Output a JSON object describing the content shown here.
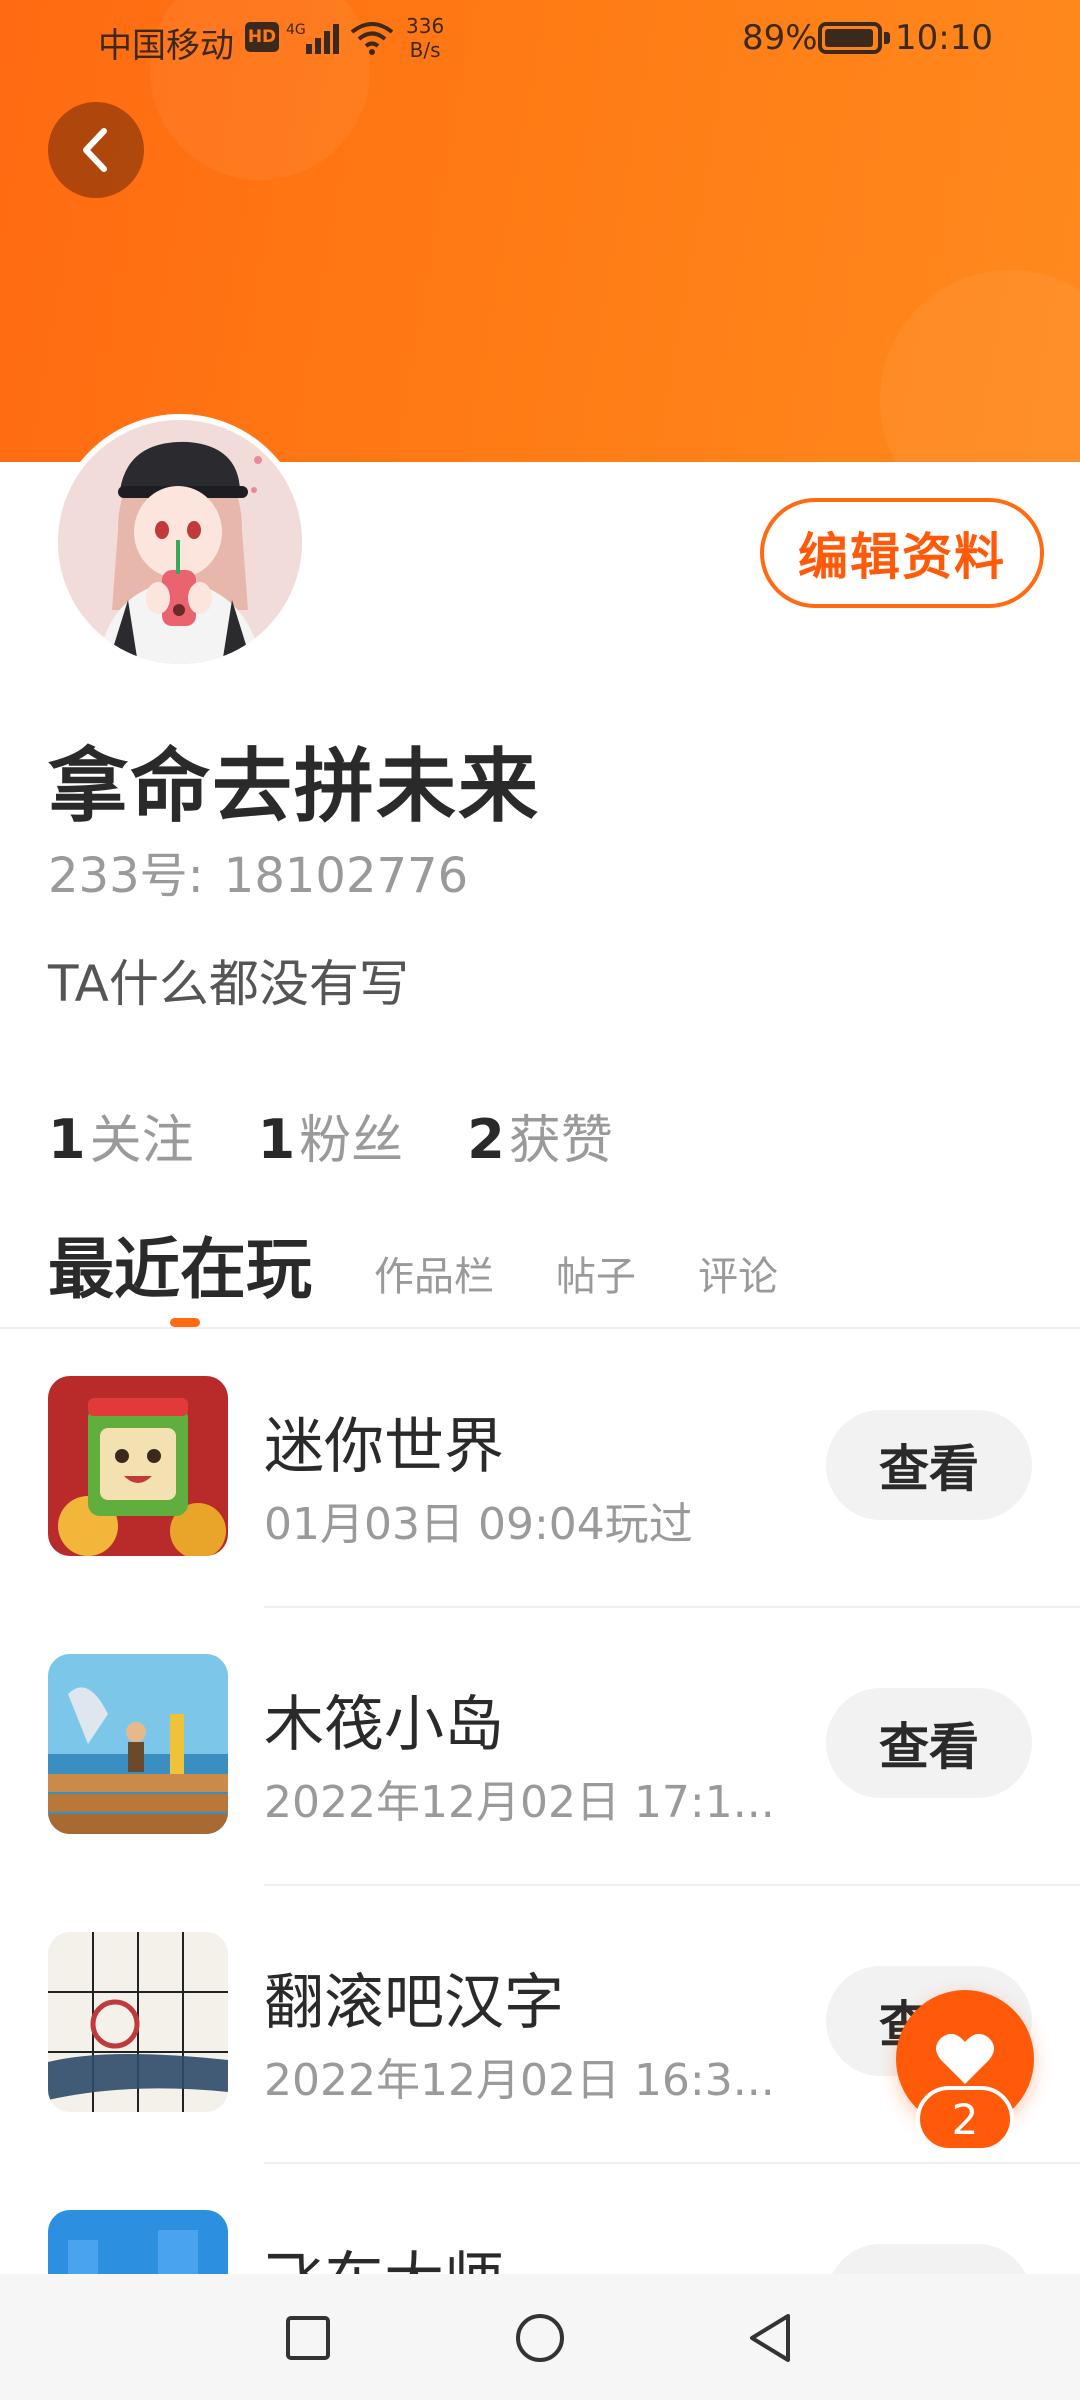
{
  "status_bar": {
    "carrier": "中国移动",
    "hd": "HD",
    "net": "4G",
    "speed_value": "336",
    "speed_unit": "B/s",
    "battery": "89%",
    "time": "10:10"
  },
  "profile": {
    "edit_label": "编辑资料",
    "nickname": "拿命去拼未来",
    "uid_label": "233号:",
    "uid_value": "18102776",
    "bio": "TA什么都没有写",
    "stats": [
      {
        "num": "1",
        "label": "关注"
      },
      {
        "num": "1",
        "label": "粉丝"
      },
      {
        "num": "2",
        "label": "获赞"
      }
    ]
  },
  "tabs": [
    {
      "label": "最近在玩",
      "active": true
    },
    {
      "label": "作品栏",
      "active": false
    },
    {
      "label": "帖子",
      "active": false
    },
    {
      "label": "评论",
      "active": false
    }
  ],
  "games": [
    {
      "name": "迷你世界",
      "time": "01月03日 09:04玩过",
      "button": "查看",
      "icon": "mini-world-icon"
    },
    {
      "name": "木筏小岛",
      "time": "2022年12月02日 17:1...",
      "button": "查看",
      "icon": "raft-island-icon"
    },
    {
      "name": "翻滚吧汉字",
      "time": "2022年12月02日 16:3...",
      "button": "查看",
      "icon": "hanzi-game-icon"
    },
    {
      "name": "飞车大师",
      "time": "",
      "button": "",
      "icon": "racing-game-icon"
    }
  ],
  "like_fab": {
    "count": "2"
  },
  "colors": {
    "accent": "#ff6a12",
    "banner": "#ff7a14"
  }
}
